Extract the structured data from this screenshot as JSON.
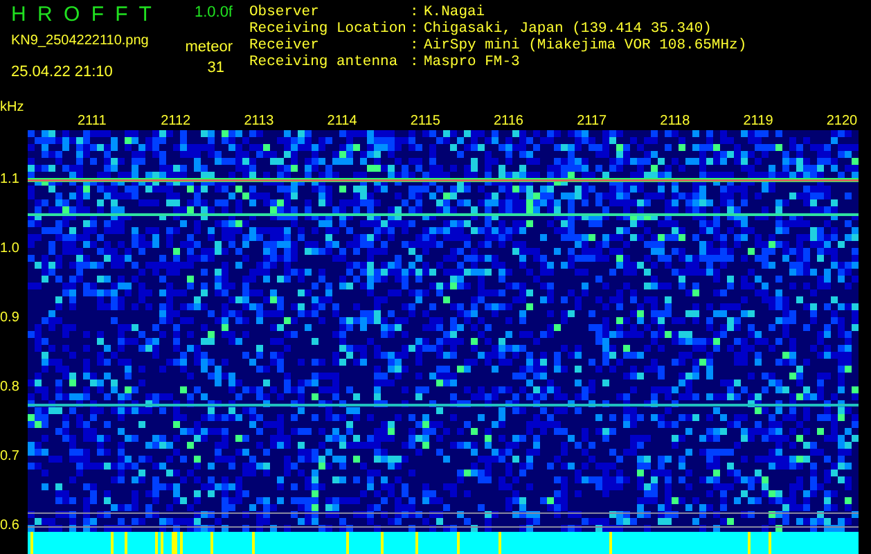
{
  "header": {
    "title": "H R O F F T",
    "version": "1.0.0f",
    "filename": "KN9_2504222110.png",
    "datetime": "25.04.22 21:10",
    "meteor_label": "meteor",
    "meteor_count": "31"
  },
  "info": [
    {
      "label": "Observer",
      "value": "K.Nagai"
    },
    {
      "label": "Receiving Location",
      "value": "Chigasaki, Japan (139.414 35.340)"
    },
    {
      "label": "Receiver",
      "value": "AirSpy mini (Miakejima VOR 108.65MHz)"
    },
    {
      "label": "Receiving antenna",
      "value": "Maspro FM-3"
    }
  ],
  "separator": ":",
  "axis": {
    "unit": "kHz",
    "labels": [
      "1.1",
      "1.0",
      "0.9",
      "0.8",
      "0.7",
      "0.6"
    ]
  },
  "time_labels": [
    "2111",
    "2112",
    "2113",
    "2114",
    "2115",
    "2116",
    "2117",
    "2118",
    "2119",
    "2120"
  ]
}
